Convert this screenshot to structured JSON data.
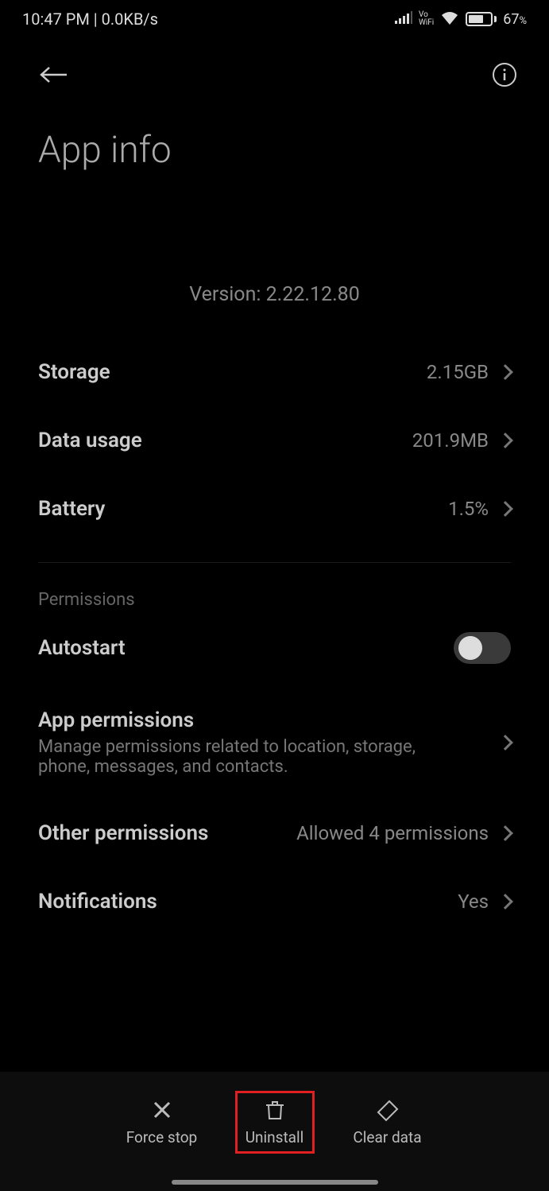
{
  "status": {
    "time": "10:47 PM",
    "speed": "0.0KB/s",
    "vo": "Vo",
    "wifi_label": "WiFi",
    "battery_pct": "67",
    "battery_suffix": "%"
  },
  "page": {
    "title": "App info",
    "version_label": "Version: 2.22.12.80"
  },
  "rows": {
    "storage": {
      "label": "Storage",
      "value": "2.15GB"
    },
    "data_usage": {
      "label": "Data usage",
      "value": "201.9MB"
    },
    "battery": {
      "label": "Battery",
      "value": "1.5%"
    }
  },
  "permissions": {
    "section": "Permissions",
    "autostart": "Autostart",
    "app_permissions": {
      "title": "App permissions",
      "subtitle": "Manage permissions related to location, storage, phone, messages, and contacts."
    },
    "other": {
      "title": "Other permissions",
      "value": "Allowed 4 permissions"
    },
    "notifications": {
      "title": "Notifications",
      "value": "Yes"
    }
  },
  "bottom": {
    "force_stop": "Force stop",
    "uninstall": "Uninstall",
    "clear_data": "Clear data"
  }
}
